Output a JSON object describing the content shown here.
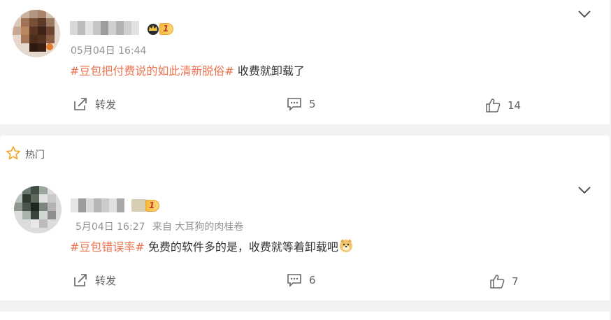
{
  "posts": [
    {
      "timestamp": "05月04日 16:44",
      "source": "",
      "topic": "#豆包把付费说的如此清新脱俗#",
      "text": " 收费就卸载了",
      "level": "1",
      "actions": {
        "repost_label": "转发",
        "comments": "5",
        "likes": "14"
      }
    },
    {
      "timestamp": "5月04日 16:27",
      "source": "来自 大耳狗的肉桂卷",
      "topic": "#豆包错误率#",
      "text": " 免费的软件多的是，收费就等着卸载吧",
      "level": "1",
      "actions": {
        "repost_label": "转发",
        "comments": "6",
        "likes": "7"
      }
    }
  ],
  "section": {
    "hot_label": "热门"
  },
  "colors": {
    "topic": "#eb7350",
    "meta": "#939393",
    "background": "#f2f2f2",
    "accent_star": "#f5a623"
  },
  "icons": [
    "chevron-down-icon",
    "repost-icon",
    "comment-icon",
    "like-icon",
    "star-icon",
    "crown-icon",
    "dog-emoji"
  ]
}
